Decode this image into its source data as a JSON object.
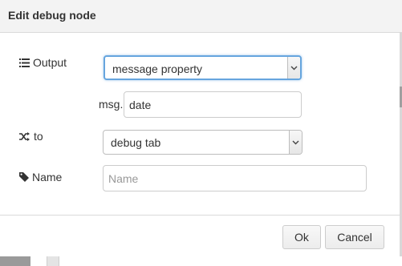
{
  "dialog": {
    "title": "Edit debug node"
  },
  "form": {
    "output_label": "Output",
    "output_select_value": "message property",
    "msg_prefix": "msg.",
    "property_value": "date",
    "to_label": "to",
    "to_select_value": "debug tab",
    "name_label": "Name",
    "name_placeholder": "Name",
    "name_value": ""
  },
  "footer": {
    "ok_label": "Ok",
    "cancel_label": "Cancel"
  },
  "icons": {
    "output": "list-icon",
    "to": "shuffle-icon",
    "name": "tag-icon",
    "dropdown": "chevron-down-icon"
  },
  "colors": {
    "focus_border": "#66a5de",
    "titlebar_bg": "#f3f3f3"
  }
}
